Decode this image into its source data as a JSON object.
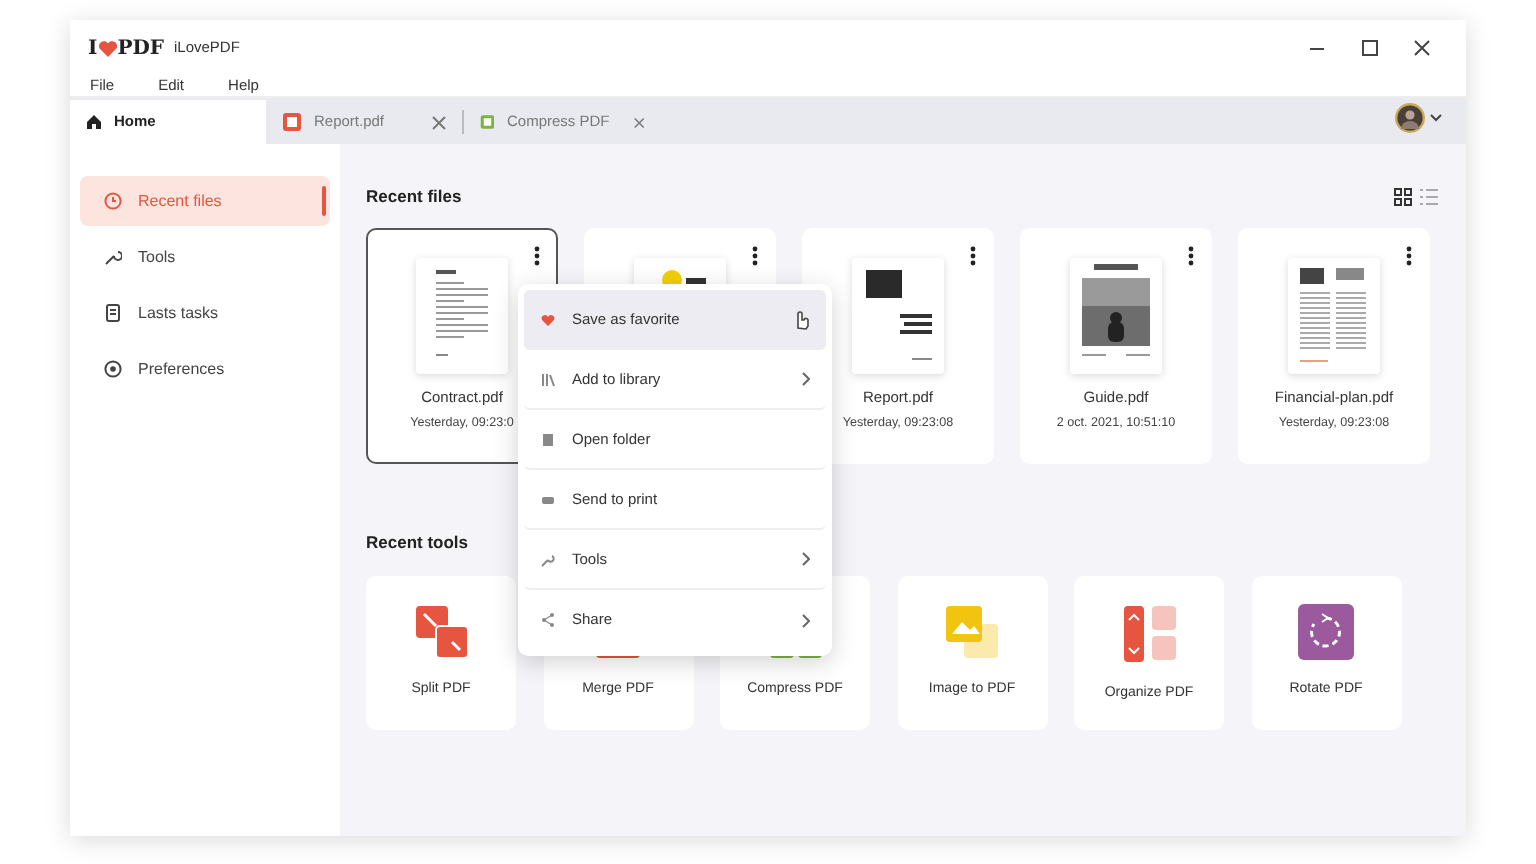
{
  "window": {
    "logo": {
      "left": "I",
      "right": "PDF"
    },
    "title": "iLovePDF"
  },
  "menu_bar": [
    "File",
    "Edit",
    "Help"
  ],
  "tabs": [
    {
      "label": "Home",
      "selected": true,
      "closable": false
    },
    {
      "label": "Report.pdf",
      "selected": false,
      "closable": true,
      "color": "#e5553f"
    },
    {
      "label": "Compress PDF",
      "selected": false,
      "closable": true,
      "color": "#7cb342"
    }
  ],
  "sidebar": {
    "items": [
      {
        "label": "Recent files",
        "selected": true
      },
      {
        "label": "Tools",
        "selected": false
      },
      {
        "label": "Lasts tasks",
        "selected": false
      },
      {
        "label": "Preferences",
        "selected": false
      }
    ]
  },
  "recent_files": {
    "title": "Recent files",
    "files": [
      {
        "name": "Contract.pdf",
        "date": "Yesterday, 09:23:0",
        "selected": true
      },
      {
        "selected": false
      },
      {
        "name": "Report.pdf",
        "date": "Yesterday, 09:23:08",
        "selected": false
      },
      {
        "name": "Guide.pdf",
        "date": "2 oct. 2021, 10:51:10",
        "selected": false
      },
      {
        "name": "Financial-plan.pdf",
        "date": "Yesterday, 09:23:08",
        "selected": false
      }
    ]
  },
  "context_menu": {
    "items": [
      {
        "label": "Save as favorite",
        "selected": true,
        "submenu": false
      },
      {
        "label": "Add to library",
        "selected": false,
        "submenu": true
      },
      {
        "label": "Open folder",
        "selected": false,
        "submenu": false
      },
      {
        "label": "Send to print",
        "selected": false,
        "submenu": false
      },
      {
        "label": "Tools",
        "selected": false,
        "submenu": true
      },
      {
        "label": "Share",
        "selected": false,
        "submenu": true
      }
    ]
  },
  "recent_tools": {
    "title": "Recent tools",
    "tools": [
      {
        "label": "Split PDF",
        "color": "#e5553f"
      },
      {
        "label": "Merge PDF"
      },
      {
        "label": "Compress PDF"
      },
      {
        "label": "Image to PDF",
        "color": "#f2c40f"
      },
      {
        "label": "Organize PDF",
        "color": "#e5553f"
      },
      {
        "label": "Rotate PDF",
        "color": "#9b5a9e"
      }
    ]
  }
}
